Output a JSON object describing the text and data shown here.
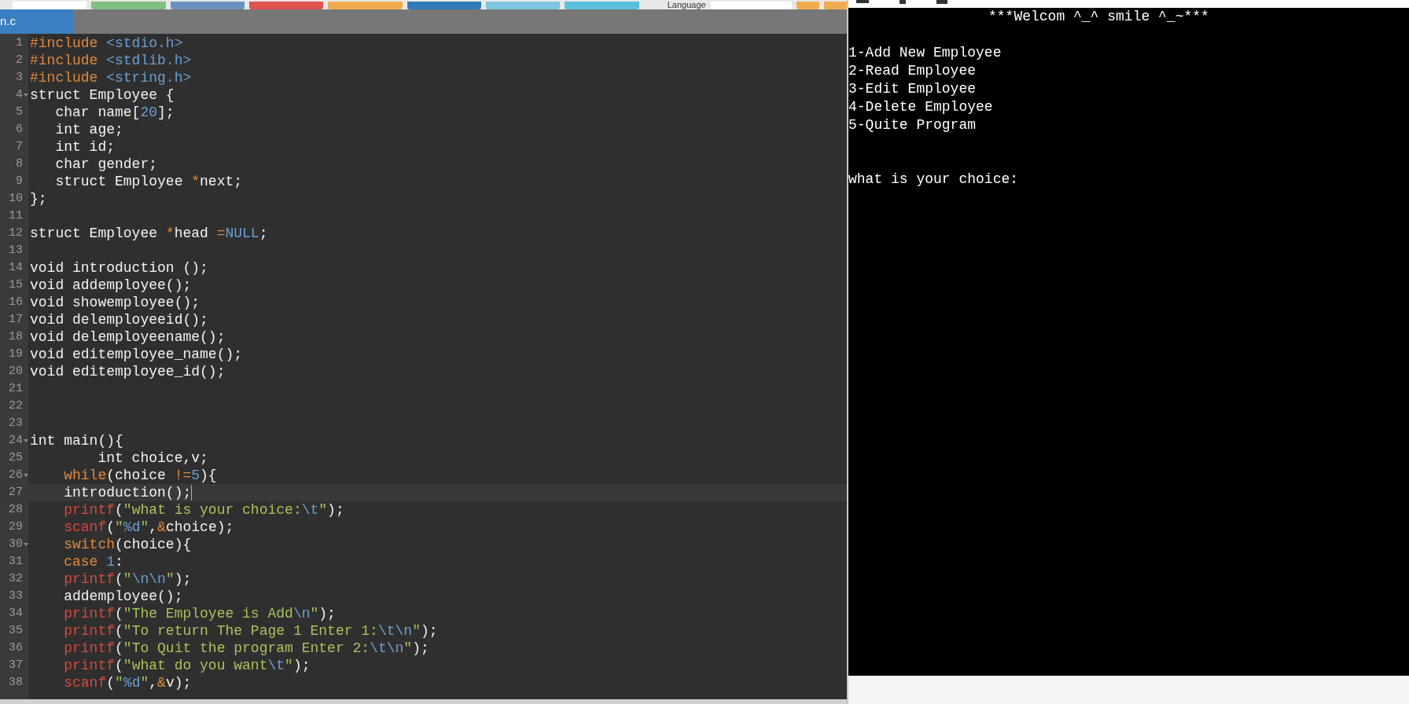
{
  "toolbar": {
    "buttons": [
      {
        "color": "#ffffff"
      },
      {
        "color": "#7fbf7f"
      },
      {
        "color": "#6c93c0"
      },
      {
        "color": "#df5350"
      },
      {
        "color": "#f0ad4e"
      },
      {
        "color": "#337ab7"
      },
      {
        "color": "#7ec5df"
      },
      {
        "color": "#5bc0de"
      }
    ],
    "language_label": "Language",
    "icon_buttons": [
      {
        "color": "#f0ad4e"
      },
      {
        "color": "#f0ad4e"
      }
    ]
  },
  "tabs": [
    {
      "label": "n.c",
      "selected": true
    }
  ],
  "editor": {
    "lines": [
      {
        "number": "1",
        "tokens": [
          {
            "kind": "keyword",
            "text": "#include "
          },
          {
            "kind": "number",
            "text": "<stdio.h>"
          }
        ]
      },
      {
        "number": "2",
        "tokens": [
          {
            "kind": "keyword",
            "text": "#include "
          },
          {
            "kind": "number",
            "text": "<stdlib.h>"
          }
        ]
      },
      {
        "number": "3",
        "tokens": [
          {
            "kind": "keyword",
            "text": "#include "
          },
          {
            "kind": "number",
            "text": "<string.h>"
          }
        ]
      },
      {
        "number": "4",
        "foldable": true,
        "tokens": [
          {
            "kind": "plain",
            "text": "struct Employee {"
          }
        ]
      },
      {
        "number": "5",
        "tokens": [
          {
            "kind": "plain",
            "text": "   char name["
          },
          {
            "kind": "number",
            "text": "20"
          },
          {
            "kind": "plain",
            "text": "];"
          }
        ]
      },
      {
        "number": "6",
        "tokens": [
          {
            "kind": "plain",
            "text": "   int age;"
          }
        ]
      },
      {
        "number": "7",
        "tokens": [
          {
            "kind": "plain",
            "text": "   int id;"
          }
        ]
      },
      {
        "number": "8",
        "tokens": [
          {
            "kind": "plain",
            "text": "   char gender;"
          }
        ]
      },
      {
        "number": "9",
        "tokens": [
          {
            "kind": "plain",
            "text": "   struct Employee "
          },
          {
            "kind": "operator",
            "text": "*"
          },
          {
            "kind": "plain",
            "text": "next;"
          }
        ]
      },
      {
        "number": "10",
        "tokens": [
          {
            "kind": "plain",
            "text": "};"
          }
        ]
      },
      {
        "number": "11"
      },
      {
        "number": "12",
        "tokens": [
          {
            "kind": "plain",
            "text": "struct Employee "
          },
          {
            "kind": "operator",
            "text": "*"
          },
          {
            "kind": "plain",
            "text": "head "
          },
          {
            "kind": "operator",
            "text": "="
          },
          {
            "kind": "number",
            "text": "NULL"
          },
          {
            "kind": "plain",
            "text": ";"
          }
        ]
      },
      {
        "number": "13"
      },
      {
        "number": "14",
        "tokens": [
          {
            "kind": "plain",
            "text": "void introduction ();"
          }
        ]
      },
      {
        "number": "15",
        "tokens": [
          {
            "kind": "plain",
            "text": "void addemployee();"
          }
        ]
      },
      {
        "number": "16",
        "tokens": [
          {
            "kind": "plain",
            "text": "void showemployee();"
          }
        ]
      },
      {
        "number": "17",
        "tokens": [
          {
            "kind": "plain",
            "text": "void delemployeeid();"
          }
        ]
      },
      {
        "number": "18",
        "tokens": [
          {
            "kind": "plain",
            "text": "void delemployeename();"
          }
        ]
      },
      {
        "number": "19",
        "tokens": [
          {
            "kind": "plain",
            "text": "void editemployee_name();"
          }
        ]
      },
      {
        "number": "20",
        "tokens": [
          {
            "kind": "plain",
            "text": "void editemployee_id();"
          }
        ]
      },
      {
        "number": "21"
      },
      {
        "number": "22"
      },
      {
        "number": "23"
      },
      {
        "number": "24",
        "foldable": true,
        "tokens": [
          {
            "kind": "plain",
            "text": "int main(){"
          }
        ]
      },
      {
        "number": "25",
        "tokens": [
          {
            "kind": "plain",
            "text": "        int choice,v;"
          }
        ]
      },
      {
        "number": "26",
        "foldable": true,
        "tokens": [
          {
            "kind": "keyword",
            "text": "    while"
          },
          {
            "kind": "plain",
            "text": "(choice "
          },
          {
            "kind": "operator",
            "text": "!="
          },
          {
            "kind": "number",
            "text": "5"
          },
          {
            "kind": "plain",
            "text": "){"
          }
        ]
      },
      {
        "number": "27",
        "current": true,
        "tokens": [
          {
            "kind": "plain",
            "text": "    introduction();"
          }
        ]
      },
      {
        "number": "28",
        "tokens": [
          {
            "kind": "function",
            "text": "    printf"
          },
          {
            "kind": "plain",
            "text": "("
          },
          {
            "kind": "string",
            "text": "\"what is your choice:"
          },
          {
            "kind": "number",
            "text": "\\t"
          },
          {
            "kind": "string",
            "text": "\""
          },
          {
            "kind": "plain",
            "text": ");"
          }
        ]
      },
      {
        "number": "29",
        "tokens": [
          {
            "kind": "function",
            "text": "    scanf"
          },
          {
            "kind": "plain",
            "text": "("
          },
          {
            "kind": "string",
            "text": "\""
          },
          {
            "kind": "number",
            "text": "%d"
          },
          {
            "kind": "string",
            "text": "\""
          },
          {
            "kind": "plain",
            "text": ","
          },
          {
            "kind": "operator",
            "text": "&"
          },
          {
            "kind": "plain",
            "text": "choice);"
          }
        ]
      },
      {
        "number": "30",
        "foldable": true,
        "tokens": [
          {
            "kind": "keyword",
            "text": "    switch"
          },
          {
            "kind": "plain",
            "text": "(choice){"
          }
        ]
      },
      {
        "number": "31",
        "tokens": [
          {
            "kind": "keyword",
            "text": "    case "
          },
          {
            "kind": "number",
            "text": "1"
          },
          {
            "kind": "plain",
            "text": ":"
          }
        ]
      },
      {
        "number": "32",
        "tokens": [
          {
            "kind": "function",
            "text": "    printf"
          },
          {
            "kind": "plain",
            "text": "("
          },
          {
            "kind": "string",
            "text": "\""
          },
          {
            "kind": "number",
            "text": "\\n\\n"
          },
          {
            "kind": "string",
            "text": "\""
          },
          {
            "kind": "plain",
            "text": ");"
          }
        ]
      },
      {
        "number": "33",
        "tokens": [
          {
            "kind": "plain",
            "text": "    addemployee();"
          }
        ]
      },
      {
        "number": "34",
        "tokens": [
          {
            "kind": "function",
            "text": "    printf"
          },
          {
            "kind": "plain",
            "text": "("
          },
          {
            "kind": "string",
            "text": "\"The Employee is Add"
          },
          {
            "kind": "number",
            "text": "\\n"
          },
          {
            "kind": "string",
            "text": "\""
          },
          {
            "kind": "plain",
            "text": ");"
          }
        ]
      },
      {
        "number": "35",
        "tokens": [
          {
            "kind": "function",
            "text": "    printf"
          },
          {
            "kind": "plain",
            "text": "("
          },
          {
            "kind": "string",
            "text": "\"To return The Page 1 Enter 1:"
          },
          {
            "kind": "number",
            "text": "\\t\\n"
          },
          {
            "kind": "string",
            "text": "\""
          },
          {
            "kind": "plain",
            "text": ");"
          }
        ]
      },
      {
        "number": "36",
        "tokens": [
          {
            "kind": "function",
            "text": "    printf"
          },
          {
            "kind": "plain",
            "text": "("
          },
          {
            "kind": "string",
            "text": "\"To Quit the program Enter 2:"
          },
          {
            "kind": "number",
            "text": "\\t\\n"
          },
          {
            "kind": "string",
            "text": "\""
          },
          {
            "kind": "plain",
            "text": ");"
          }
        ]
      },
      {
        "number": "37",
        "tokens": [
          {
            "kind": "function",
            "text": "    printf"
          },
          {
            "kind": "plain",
            "text": "("
          },
          {
            "kind": "string",
            "text": "\"what do you want"
          },
          {
            "kind": "number",
            "text": "\\t"
          },
          {
            "kind": "string",
            "text": "\""
          },
          {
            "kind": "plain",
            "text": ");"
          }
        ]
      },
      {
        "number": "38",
        "tokens": [
          {
            "kind": "function",
            "text": "    scanf"
          },
          {
            "kind": "plain",
            "text": "("
          },
          {
            "kind": "string",
            "text": "\""
          },
          {
            "kind": "number",
            "text": "%d"
          },
          {
            "kind": "string",
            "text": "\""
          },
          {
            "kind": "plain",
            "text": ","
          },
          {
            "kind": "operator",
            "text": "&"
          },
          {
            "kind": "plain",
            "text": "v);"
          }
        ]
      }
    ]
  },
  "console": {
    "header": "***Welcom ^_^ smile ^_~***",
    "menu": [
      "1-Add New Employee",
      "2-Read Employee",
      "3-Edit Employee",
      "4-Delete Employee",
      "5-Quite Program"
    ],
    "prompt": "what is your choice:"
  }
}
